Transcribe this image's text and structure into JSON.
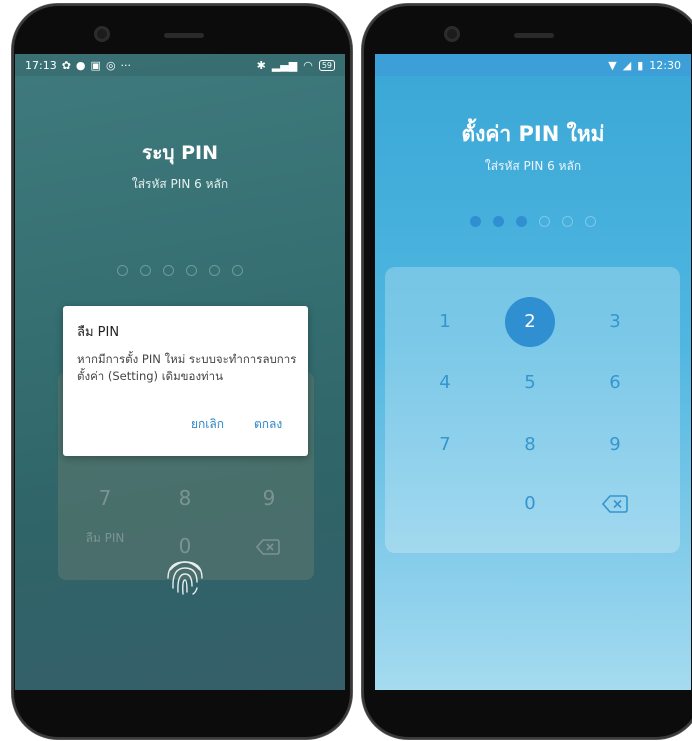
{
  "left": {
    "status": {
      "time": "17:13",
      "ellipsis": "···",
      "battery": "59"
    },
    "title": "ระบุ PIN",
    "subtitle": "ใส่รหัส PIN 6 หลัก",
    "keys": [
      "7",
      "8",
      "9",
      "0"
    ],
    "forgot_label": "ลืม PIN",
    "dialog": {
      "title": "ลืม PIN",
      "message": "หากมีการตั้ง PIN ใหม่ ระบบจะทำการลบการตั้งค่า (Setting) เดิมของท่าน",
      "cancel": "ยกเลิก",
      "ok": "ตกลง"
    }
  },
  "right": {
    "status": {
      "time": "12:30"
    },
    "title": "ตั้งค่า PIN ใหม่",
    "subtitle": "ใส่รหัส PIN 6 หลัก",
    "pin_filled": 3,
    "pin_length": 6,
    "keys": [
      "1",
      "2",
      "3",
      "4",
      "5",
      "6",
      "7",
      "8",
      "9",
      "0"
    ],
    "active_key": "2"
  },
  "colors": {
    "accent": "#2f8fd0",
    "dialog_button": "#2a86c7"
  }
}
